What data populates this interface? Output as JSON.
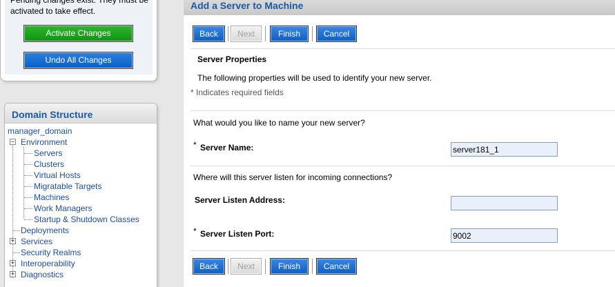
{
  "change_center": {
    "pending_text": "Pending changes exist. They must be activated to take effect.",
    "activate_label": "Activate Changes",
    "undo_label": "Undo All Changes"
  },
  "domain_structure": {
    "title": "Domain Structure",
    "root": "manager_domain",
    "environment": "Environment",
    "environment_children": [
      "Servers",
      "Clusters",
      "Virtual Hosts",
      "Migratable Targets",
      "Machines",
      "Work Managers",
      "Startup & Shutdown Classes"
    ],
    "deployments": "Deployments",
    "services": "Services",
    "security_realms": "Security Realms",
    "interoperability": "Interoperability",
    "diagnostics": "Diagnostics",
    "expander_minus": "−",
    "expander_plus": "+"
  },
  "main": {
    "title": "Add a Server to Machine",
    "buttons": {
      "back": "Back",
      "next": "Next",
      "finish": "Finish",
      "cancel": "Cancel"
    },
    "section_title": "Server Properties",
    "section_desc": "The following properties will be used to identify your new server.",
    "required_note": "* Indicates required fields",
    "q_name": "What would you like to name your new server?",
    "server_name_label": "Server Name:",
    "server_name_value": "server181_1",
    "q_listen": "Where will this server listen for incoming connections?",
    "listen_address_label": "Server Listen Address:",
    "listen_address_value": "",
    "listen_port_label": "Server Listen Port:",
    "listen_port_value": "9002",
    "asterisk": "*"
  }
}
